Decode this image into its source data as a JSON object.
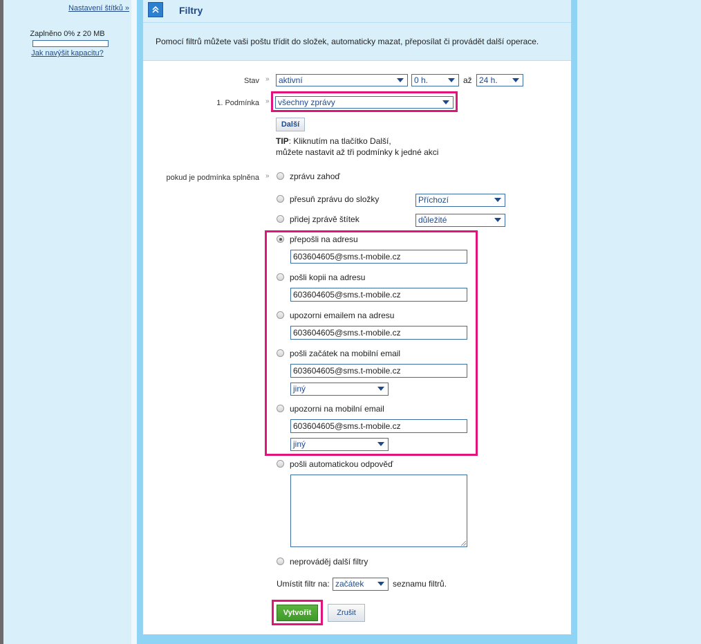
{
  "sidebar": {
    "tags_link": "Nastavení štítků »",
    "capacity_text": "Zaplněno 0% z 20 MB",
    "capacity_used_fraction": 0,
    "capacity_link": "Jak navýšit kapacitu?"
  },
  "header": {
    "title": "Filtry"
  },
  "intro": "Pomocí filtrů můžete vaši poštu třídit do složek, automaticky mazat, přeposílat či provádět další operace.",
  "form": {
    "state": {
      "label": "Stav",
      "value": "aktivní",
      "from": "0 h.",
      "to_label": "až",
      "to": "24 h."
    },
    "condition": {
      "label": "1. Podmínka",
      "value": "všechny zprávy",
      "next_button": "Další",
      "tip_bold": "TIP",
      "tip_line1": ": Kliknutím na tlačítko Další,",
      "tip_line2": "můžete nastavit až tři podmínky k jedné akci"
    },
    "actions": {
      "label": "pokud je podmínka splněna",
      "discard": "zprávu zahoď",
      "move": "přesuň zprávu do složky",
      "move_folder": "Příchozí",
      "tag": "přidej zprávě štítek",
      "tag_value": "důležité",
      "forward": "přepošli na adresu",
      "forward_addr": "603604605@sms.t-mobile.cz",
      "copy": "pošli kopii na adresu",
      "copy_addr": "603604605@sms.t-mobile.cz",
      "notify_email": "upozorni emailem na adresu",
      "notify_email_addr": "603604605@sms.t-mobile.cz",
      "mobile_start": "pošli začátek na mobilní email",
      "mobile_start_addr": "603604605@sms.t-mobile.cz",
      "mobile_start_type": "jiný",
      "notify_mobile": "upozorni na mobilní email",
      "notify_mobile_addr": "603604605@sms.t-mobile.cz",
      "notify_mobile_type": "jiný",
      "autoreply": "pošli automatickou odpověď",
      "no_more_filters": "neprováděj další filtry"
    },
    "placement": {
      "label": "Umístit filtr na:",
      "value": "začátek",
      "suffix": "seznamu filtrů."
    },
    "create_button": "Vytvořit",
    "cancel_button": "Zrušit"
  },
  "colors": {
    "highlight": "#e0147a",
    "create_button": "#3f9a2a",
    "accent": "#1f4a8a",
    "panel_bg": "#d9f0fb"
  }
}
